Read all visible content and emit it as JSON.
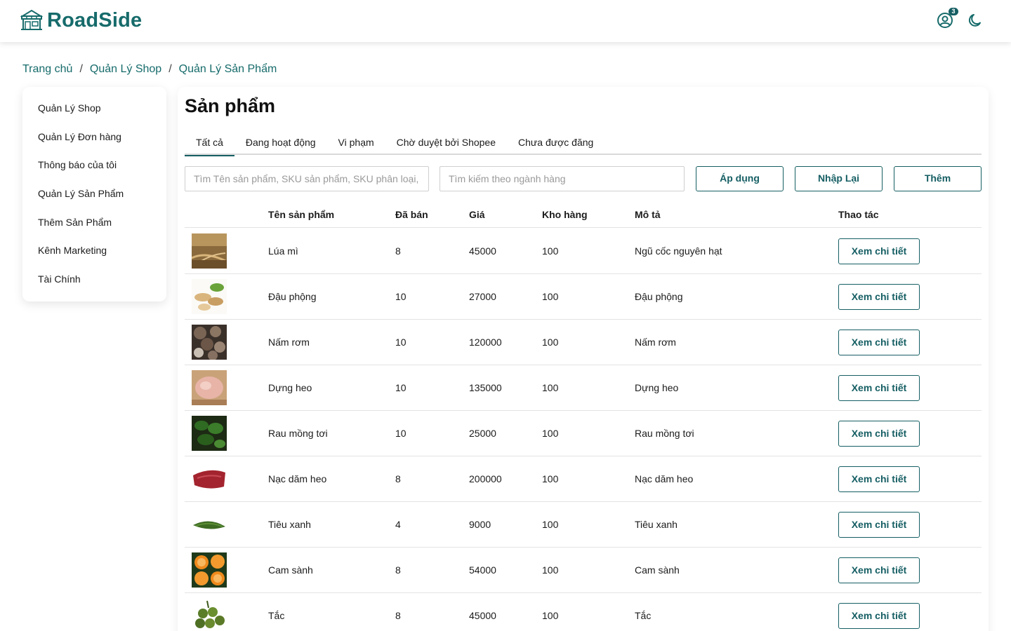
{
  "header": {
    "logo_text": "RoadSide",
    "notification_count": "3",
    "accent_color": "#176b6b"
  },
  "breadcrumb": [
    "Trang chủ",
    "Quản Lý Shop",
    "Quản Lý Sản Phẩm"
  ],
  "sidebar": {
    "items": [
      {
        "label": "Quản Lý Shop"
      },
      {
        "label": "Quản Lý Đơn hàng"
      },
      {
        "label": "Thông báo của tôi"
      },
      {
        "label": "Quản Lý Sản Phẩm"
      },
      {
        "label": "Thêm Sản Phẩm"
      },
      {
        "label": "Kênh Marketing"
      },
      {
        "label": "Tài Chính"
      }
    ]
  },
  "main": {
    "title": "Sản phẩm",
    "tabs": [
      {
        "label": "Tất cả",
        "active": true
      },
      {
        "label": "Đang hoạt động"
      },
      {
        "label": "Vi phạm"
      },
      {
        "label": "Chờ duyệt bởi Shopee"
      },
      {
        "label": "Chưa được đăng"
      }
    ],
    "search": {
      "product_placeholder": "Tìm Tên sản phẩm, SKU sản phẩm, SKU phân loại, Mã sản phẩm",
      "category_placeholder": "Tìm kiếm theo ngành hàng"
    },
    "buttons": {
      "apply": "Áp dụng",
      "reset": "Nhập Lại",
      "add": "Thêm"
    },
    "table": {
      "columns": [
        "Tên sản phẩm",
        "Đã bán",
        "Giá",
        "Kho hàng",
        "Mô tả",
        "Thao tác"
      ],
      "action_label": "Xem chi tiết",
      "rows": [
        {
          "name": "Lúa mì",
          "sold": "8",
          "price": "45000",
          "stock": "100",
          "desc": "Ngũ cốc nguyên hạt",
          "image": "wheat-image"
        },
        {
          "name": "Đậu phộng",
          "sold": "10",
          "price": "27000",
          "stock": "100",
          "desc": "Đậu phộng",
          "image": "peanut-image"
        },
        {
          "name": "Nấm rơm",
          "sold": "10",
          "price": "120000",
          "stock": "100",
          "desc": "Nấm rơm",
          "image": "mushroom-image"
        },
        {
          "name": "Dựng heo",
          "sold": "10",
          "price": "135000",
          "stock": "100",
          "desc": "Dựng heo",
          "image": "pork-image"
        },
        {
          "name": "Rau mồng tơi",
          "sold": "10",
          "price": "25000",
          "stock": "100",
          "desc": "Rau mồng tơi",
          "image": "spinach-image"
        },
        {
          "name": "Nạc dăm heo",
          "sold": "8",
          "price": "200000",
          "stock": "100",
          "desc": "Nạc dăm heo",
          "image": "meat-image"
        },
        {
          "name": "Tiêu xanh",
          "sold": "4",
          "price": "9000",
          "stock": "100",
          "desc": "Tiêu xanh",
          "image": "pepper-image"
        },
        {
          "name": "Cam sành",
          "sold": "8",
          "price": "54000",
          "stock": "100",
          "desc": "Cam sành",
          "image": "orange-image"
        },
        {
          "name": "Tắc",
          "sold": "8",
          "price": "45000",
          "stock": "100",
          "desc": "Tắc",
          "image": "kumquat-image"
        }
      ]
    }
  }
}
